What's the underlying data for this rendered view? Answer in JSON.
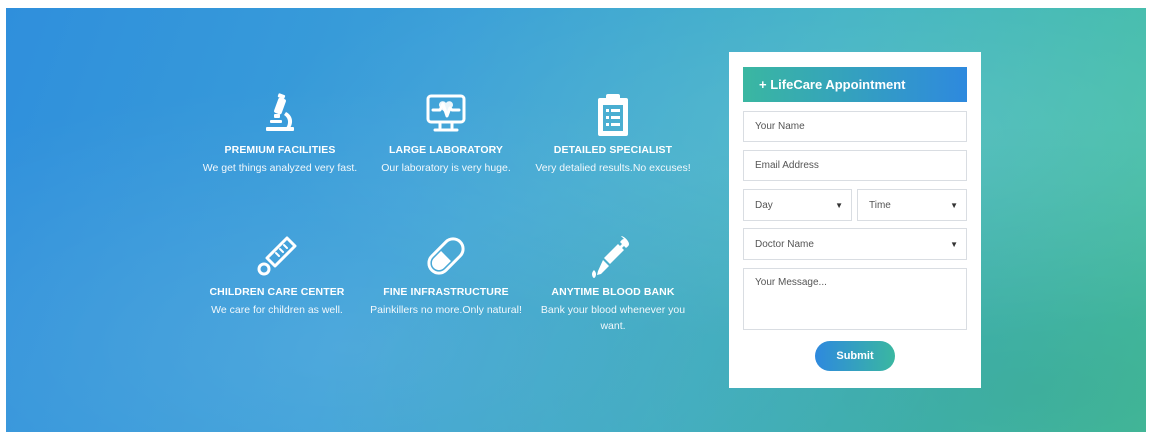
{
  "features": [
    {
      "title": "PREMIUM FACILITIES",
      "desc": "We get things analyzed very fast.",
      "icon": "microscope-icon"
    },
    {
      "title": "LARGE LABORATORY",
      "desc": "Our laboratory is very huge.",
      "icon": "heartbeat-monitor-icon"
    },
    {
      "title": "DETAILED SPECIALIST",
      "desc": "Very detalied results.No excuses!",
      "icon": "clipboard-icon"
    },
    {
      "title": "CHILDREN CARE CENTER",
      "desc": "We care for children as well.",
      "icon": "thermometer-icon"
    },
    {
      "title": "FINE INFRASTRUCTURE",
      "desc": "Painkillers no more.Only natural!",
      "icon": "pill-icon"
    },
    {
      "title": "ANYTIME BLOOD BANK",
      "desc": "Bank your blood whenever you want.",
      "icon": "dropper-icon"
    }
  ],
  "form": {
    "title": "+ LifeCare Appointment",
    "name_placeholder": "Your Name",
    "email_placeholder": "Email Address",
    "day_value": "Day",
    "time_value": "Time",
    "doctor_value": "Doctor Name",
    "message_placeholder": "Your Message...",
    "submit_label": "Submit"
  },
  "colors": {
    "gradient_start": "#2f8fdc",
    "gradient_end": "#45c1a0",
    "card_background": "#ffffff"
  }
}
